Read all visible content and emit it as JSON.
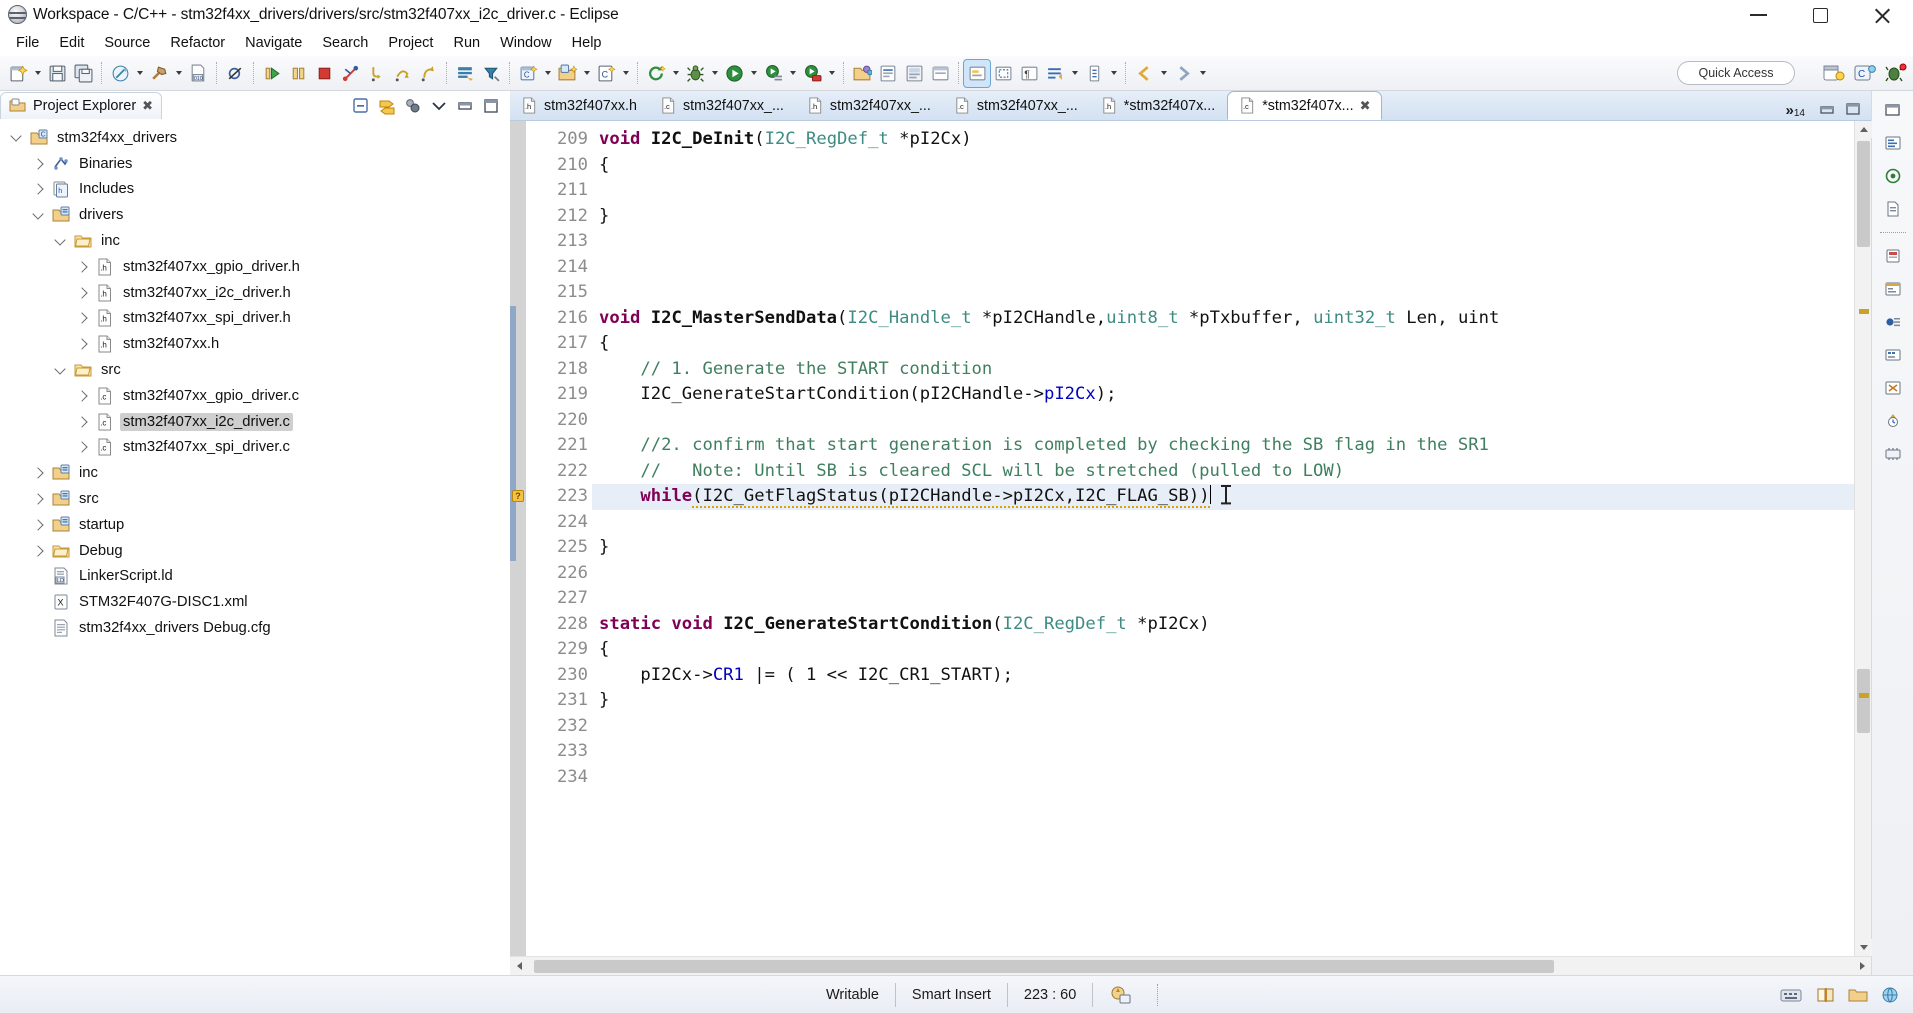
{
  "window": {
    "title": "Workspace - C/C++ - stm32f4xx_drivers/drivers/src/stm32f407xx_i2c_driver.c - Eclipse",
    "app_icon": "eclipse-icon",
    "minimize_label": "–",
    "maximize_label": "❐",
    "close_label": "✕"
  },
  "menubar": {
    "items": [
      {
        "label": "File"
      },
      {
        "label": "Edit"
      },
      {
        "label": "Source"
      },
      {
        "label": "Refactor"
      },
      {
        "label": "Navigate"
      },
      {
        "label": "Search"
      },
      {
        "label": "Project"
      },
      {
        "label": "Run"
      },
      {
        "label": "Window"
      },
      {
        "label": "Help"
      }
    ]
  },
  "toolbar": {
    "quick_access_placeholder": "Quick Access",
    "buttons": [
      {
        "name": "new-file-button",
        "icon": "new-file-icon",
        "dropdown": true
      },
      {
        "name": "save-button",
        "icon": "save-icon",
        "dropdown": false
      },
      {
        "name": "save-all-button",
        "icon": "save-all-icon",
        "dropdown": false
      },
      {
        "name": "build-all-button",
        "icon": "build-all-icon",
        "dropdown": true
      },
      {
        "name": "build-button",
        "icon": "hammer-icon",
        "dropdown": true
      },
      {
        "name": "binary-file-button",
        "icon": "binary-file-icon",
        "dropdown": false
      },
      {
        "name": "skip-breakpoints-button",
        "icon": "skip-breakpoints-icon",
        "dropdown": false
      },
      {
        "name": "resume-button",
        "icon": "resume-icon",
        "dropdown": false
      },
      {
        "name": "suspend-button",
        "icon": "suspend-icon",
        "dropdown": false
      },
      {
        "name": "terminate-button",
        "icon": "terminate-icon",
        "dropdown": false
      },
      {
        "name": "disconnect-button",
        "icon": "disconnect-icon",
        "dropdown": false
      },
      {
        "name": "step-into-button",
        "icon": "step-into-icon",
        "dropdown": false
      },
      {
        "name": "step-over-button",
        "icon": "step-over-icon",
        "dropdown": false
      },
      {
        "name": "step-return-button",
        "icon": "step-return-icon",
        "dropdown": false
      },
      {
        "name": "open-element-button",
        "icon": "open-element-icon",
        "dropdown": false
      },
      {
        "name": "search-declaration-button",
        "icon": "search-declaration-icon",
        "dropdown": false
      },
      {
        "name": "new-c-project-button",
        "icon": "new-c-project-icon",
        "dropdown": true
      },
      {
        "name": "new-cpp-project-button",
        "icon": "new-cpp-project-icon",
        "dropdown": true
      },
      {
        "name": "new-c-class-button",
        "icon": "new-c-class-icon",
        "dropdown": true
      },
      {
        "name": "refresh-button",
        "icon": "refresh-icon",
        "dropdown": true
      },
      {
        "name": "debug-button",
        "icon": "debug-bug-icon",
        "dropdown": true
      },
      {
        "name": "run-button",
        "icon": "run-play-icon",
        "dropdown": true
      },
      {
        "name": "external-tools-button",
        "icon": "external-tools-icon",
        "dropdown": true
      },
      {
        "name": "run-last-tool-button",
        "icon": "run-last-tool-icon",
        "dropdown": true
      },
      {
        "name": "open-resource-button",
        "icon": "open-folder-icon",
        "dropdown": false
      },
      {
        "name": "open-type-button",
        "icon": "open-type-icon",
        "dropdown": false
      },
      {
        "name": "pin-editor-button",
        "icon": "pin-icon",
        "dropdown": false
      },
      {
        "name": "new-window-button",
        "icon": "new-window-icon",
        "dropdown": false
      },
      {
        "name": "toggle-mark-occurrences-button",
        "icon": "mark-occurrences-icon",
        "dropdown": false
      },
      {
        "name": "toggle-block-selection-button",
        "icon": "block-selection-icon",
        "dropdown": false
      },
      {
        "name": "show-whitespace-button",
        "icon": "whitespace-icon",
        "dropdown": false
      },
      {
        "name": "toggle-word-wrap-button",
        "icon": "word-wrap-icon",
        "dropdown": true
      },
      {
        "name": "next-annotation-button",
        "icon": "next-annotation-icon",
        "dropdown": true
      },
      {
        "name": "back-button",
        "icon": "back-arrow-icon",
        "dropdown": true
      },
      {
        "name": "forward-button",
        "icon": "forward-arrow-icon",
        "dropdown": true
      }
    ],
    "perspective_buttons": [
      {
        "name": "open-perspective-button",
        "icon": "open-perspective-icon"
      },
      {
        "name": "cpp-perspective-button",
        "icon": "cpp-perspective-icon"
      },
      {
        "name": "debug-perspective-button",
        "icon": "debug-perspective-icon"
      }
    ]
  },
  "project_explorer": {
    "tab_title": "Project Explorer",
    "close_glyph": "✖",
    "view_tools": [
      {
        "name": "collapse-all-button",
        "icon": "collapse-all-icon"
      },
      {
        "name": "link-with-editor-button",
        "icon": "link-editor-icon"
      },
      {
        "name": "focus-on-active-task-button",
        "icon": "focus-task-icon"
      },
      {
        "name": "view-menu-button",
        "icon": "chevron-down-icon"
      },
      {
        "name": "minimize-view-button",
        "icon": "minimize-icon"
      },
      {
        "name": "maximize-view-button",
        "icon": "maximize-icon"
      }
    ],
    "tree": [
      {
        "label": "stm32f4xx_drivers",
        "indent": 0,
        "twist": "down",
        "icon": "c-project-icon",
        "selected": false
      },
      {
        "label": "Binaries",
        "indent": 1,
        "twist": "right",
        "icon": "binaries-icon",
        "selected": false
      },
      {
        "label": "Includes",
        "indent": 1,
        "twist": "right",
        "icon": "includes-icon",
        "selected": false
      },
      {
        "label": "drivers",
        "indent": 1,
        "twist": "down",
        "icon": "source-folder-icon",
        "selected": false
      },
      {
        "label": "inc",
        "indent": 2,
        "twist": "down",
        "icon": "folder-icon",
        "selected": false
      },
      {
        "label": "stm32f407xx_gpio_driver.h",
        "indent": 3,
        "twist": "right",
        "icon": "header-file-icon",
        "selected": false
      },
      {
        "label": "stm32f407xx_i2c_driver.h",
        "indent": 3,
        "twist": "right",
        "icon": "header-file-icon",
        "selected": false
      },
      {
        "label": "stm32f407xx_spi_driver.h",
        "indent": 3,
        "twist": "right",
        "icon": "header-file-icon",
        "selected": false
      },
      {
        "label": "stm32f407xx.h",
        "indent": 3,
        "twist": "right",
        "icon": "header-file-icon",
        "selected": false
      },
      {
        "label": "src",
        "indent": 2,
        "twist": "down",
        "icon": "folder-icon",
        "selected": false
      },
      {
        "label": "stm32f407xx_gpio_driver.c",
        "indent": 3,
        "twist": "right",
        "icon": "c-file-icon",
        "selected": false
      },
      {
        "label": "stm32f407xx_i2c_driver.c",
        "indent": 3,
        "twist": "right",
        "icon": "c-file-icon",
        "selected": true
      },
      {
        "label": "stm32f407xx_spi_driver.c",
        "indent": 3,
        "twist": "right",
        "icon": "c-file-icon",
        "selected": false
      },
      {
        "label": "inc",
        "indent": 1,
        "twist": "right",
        "icon": "source-folder-icon",
        "selected": false
      },
      {
        "label": "src",
        "indent": 1,
        "twist": "right",
        "icon": "source-folder-icon",
        "selected": false
      },
      {
        "label": "startup",
        "indent": 1,
        "twist": "right",
        "icon": "source-folder-icon",
        "selected": false
      },
      {
        "label": "Debug",
        "indent": 1,
        "twist": "right",
        "icon": "folder-icon",
        "selected": false
      },
      {
        "label": "LinkerScript.ld",
        "indent": 1,
        "twist": "none",
        "icon": "linker-script-icon",
        "selected": false
      },
      {
        "label": "STM32F407G-DISC1.xml",
        "indent": 1,
        "twist": "none",
        "icon": "xml-file-icon",
        "selected": false
      },
      {
        "label": "stm32f4xx_drivers Debug.cfg",
        "indent": 1,
        "twist": "none",
        "icon": "cfg-file-icon",
        "selected": false
      }
    ]
  },
  "editor": {
    "tabs": [
      {
        "label": "stm32f407xx.h",
        "icon": "header-file-icon",
        "active": false,
        "dirty": false,
        "closable": false
      },
      {
        "label": "stm32f407xx_...",
        "icon": "c-file-icon",
        "active": false,
        "dirty": false,
        "closable": false
      },
      {
        "label": "stm32f407xx_...",
        "icon": "header-file-icon",
        "active": false,
        "dirty": false,
        "closable": false
      },
      {
        "label": "stm32f407xx_...",
        "icon": "c-file-icon",
        "active": false,
        "dirty": false,
        "closable": false
      },
      {
        "label": "*stm32f407x...",
        "icon": "header-file-icon",
        "active": false,
        "dirty": true,
        "closable": false
      },
      {
        "label": "*stm32f407x...",
        "icon": "c-file-icon",
        "active": true,
        "dirty": true,
        "closable": true
      }
    ],
    "overflow_indicator": "»",
    "overflow_count": "14",
    "close_glyph": "✖",
    "window_buttons": [
      {
        "name": "minimize-editor-button",
        "icon": "minimize-icon"
      },
      {
        "name": "maximize-editor-button",
        "icon": "maximize-icon"
      }
    ],
    "first_line": 209,
    "lines": [
      {
        "n": 209,
        "fold": true,
        "marker": null,
        "highlight": false,
        "tokens": [
          {
            "t": "kw",
            "s": "void"
          },
          {
            "t": "pln",
            "s": " "
          },
          {
            "t": "fn",
            "s": "I2C_DeInit"
          },
          {
            "t": "pln",
            "s": "("
          },
          {
            "t": "typ",
            "s": "I2C_RegDef_t"
          },
          {
            "t": "pln",
            "s": " *pI2Cx)"
          }
        ]
      },
      {
        "n": 210,
        "fold": false,
        "marker": null,
        "highlight": false,
        "tokens": [
          {
            "t": "pln",
            "s": "{"
          }
        ]
      },
      {
        "n": 211,
        "fold": false,
        "marker": null,
        "highlight": false,
        "tokens": []
      },
      {
        "n": 212,
        "fold": false,
        "marker": null,
        "highlight": false,
        "tokens": [
          {
            "t": "pln",
            "s": "}"
          }
        ]
      },
      {
        "n": 213,
        "fold": false,
        "marker": null,
        "highlight": false,
        "tokens": []
      },
      {
        "n": 214,
        "fold": false,
        "marker": null,
        "highlight": false,
        "tokens": []
      },
      {
        "n": 215,
        "fold": false,
        "marker": null,
        "highlight": false,
        "tokens": []
      },
      {
        "n": 216,
        "fold": true,
        "marker": null,
        "highlight": false,
        "tokens": [
          {
            "t": "kw",
            "s": "void"
          },
          {
            "t": "pln",
            "s": " "
          },
          {
            "t": "fn",
            "s": "I2C_MasterSendData"
          },
          {
            "t": "pln",
            "s": "("
          },
          {
            "t": "typ",
            "s": "I2C_Handle_t"
          },
          {
            "t": "pln",
            "s": " *pI2CHandle,"
          },
          {
            "t": "typ",
            "s": "uint8_t"
          },
          {
            "t": "pln",
            "s": " *pTxbuffer, "
          },
          {
            "t": "typ",
            "s": "uint32_t"
          },
          {
            "t": "pln",
            "s": " Len, uint"
          }
        ]
      },
      {
        "n": 217,
        "fold": false,
        "marker": null,
        "highlight": false,
        "tokens": [
          {
            "t": "pln",
            "s": "{"
          }
        ]
      },
      {
        "n": 218,
        "fold": false,
        "marker": null,
        "highlight": false,
        "tokens": [
          {
            "t": "cmt",
            "s": "    // 1. Generate the START condition"
          }
        ]
      },
      {
        "n": 219,
        "fold": false,
        "marker": null,
        "highlight": false,
        "tokens": [
          {
            "t": "pln",
            "s": "    I2C_GenerateStartCondition(pI2CHandle->"
          },
          {
            "t": "fld",
            "s": "pI2Cx"
          },
          {
            "t": "pln",
            "s": ");"
          }
        ]
      },
      {
        "n": 220,
        "fold": false,
        "marker": null,
        "highlight": false,
        "tokens": []
      },
      {
        "n": 221,
        "fold": false,
        "marker": null,
        "highlight": false,
        "tokens": [
          {
            "t": "cmt",
            "s": "    //2. confirm that start generation is completed by checking the SB flag in the SR1"
          }
        ]
      },
      {
        "n": 222,
        "fold": false,
        "marker": null,
        "highlight": false,
        "tokens": [
          {
            "t": "cmt",
            "s": "    //   Note: Until SB is cleared SCL will be stretched (pulled to LOW)"
          }
        ]
      },
      {
        "n": 223,
        "fold": false,
        "marker": "warning",
        "highlight": true,
        "tokens": [
          {
            "t": "pln",
            "s": "    "
          },
          {
            "t": "kw",
            "s": "while"
          },
          {
            "t": "err",
            "s": "(I2C_GetFlagStatus(pI2CHandle->pI2Cx,I2C_FLAG_SB))"
          },
          {
            "t": "caret",
            "s": ""
          },
          {
            "t": "ibeam",
            "s": ""
          }
        ]
      },
      {
        "n": 224,
        "fold": false,
        "marker": null,
        "highlight": false,
        "tokens": []
      },
      {
        "n": 225,
        "fold": false,
        "marker": null,
        "highlight": false,
        "tokens": [
          {
            "t": "pln",
            "s": "}"
          }
        ]
      },
      {
        "n": 226,
        "fold": false,
        "marker": null,
        "highlight": false,
        "tokens": []
      },
      {
        "n": 227,
        "fold": false,
        "marker": null,
        "highlight": false,
        "tokens": []
      },
      {
        "n": 228,
        "fold": true,
        "marker": null,
        "highlight": false,
        "tokens": [
          {
            "t": "kw",
            "s": "static void"
          },
          {
            "t": "pln",
            "s": " "
          },
          {
            "t": "fn",
            "s": "I2C_GenerateStartCondition"
          },
          {
            "t": "pln",
            "s": "("
          },
          {
            "t": "typ",
            "s": "I2C_RegDef_t"
          },
          {
            "t": "pln",
            "s": " *pI2Cx)"
          }
        ]
      },
      {
        "n": 229,
        "fold": false,
        "marker": null,
        "highlight": false,
        "tokens": [
          {
            "t": "pln",
            "s": "{"
          }
        ]
      },
      {
        "n": 230,
        "fold": false,
        "marker": null,
        "highlight": false,
        "tokens": [
          {
            "t": "pln",
            "s": "    pI2Cx->"
          },
          {
            "t": "fld",
            "s": "CR1"
          },
          {
            "t": "pln",
            "s": " |= ( 1 << I2C_CR1_START);"
          }
        ]
      },
      {
        "n": 231,
        "fold": false,
        "marker": null,
        "highlight": false,
        "tokens": [
          {
            "t": "pln",
            "s": "}"
          }
        ]
      },
      {
        "n": 232,
        "fold": false,
        "marker": null,
        "highlight": false,
        "tokens": []
      },
      {
        "n": 233,
        "fold": false,
        "marker": null,
        "highlight": false,
        "tokens": []
      },
      {
        "n": 234,
        "fold": false,
        "marker": null,
        "highlight": false,
        "tokens": []
      }
    ]
  },
  "rightbar": {
    "icons": [
      {
        "name": "restore-view-icon"
      },
      {
        "name": "outline-view-icon"
      },
      {
        "name": "build-targets-view-icon"
      },
      {
        "name": "documents-view-icon"
      },
      {
        "name": "separator"
      },
      {
        "name": "debug-view-icon"
      },
      {
        "name": "variables-view-icon"
      },
      {
        "name": "breakpoints-view-icon"
      },
      {
        "name": "registers-view-icon"
      },
      {
        "name": "expressions-view-icon"
      },
      {
        "name": "peripherals-view-icon"
      },
      {
        "name": "memory-view-icon"
      }
    ]
  },
  "statusbar": {
    "writable": "Writable",
    "insert_mode": "Smart Insert",
    "cursor_position": "223 : 60",
    "build_icon": "build-status-icon",
    "right_icons": [
      {
        "name": "keyboard-status-icon"
      },
      {
        "name": "book-status-icon"
      },
      {
        "name": "folder-status-icon"
      },
      {
        "name": "globe-status-icon"
      }
    ]
  },
  "colors": {
    "keyword": "#7f0055",
    "comment": "#3f7f5f",
    "type": "#3d8b83",
    "field": "#0000c0",
    "selection": "#e8eef7",
    "tree_selection": "#cfcfcf"
  }
}
